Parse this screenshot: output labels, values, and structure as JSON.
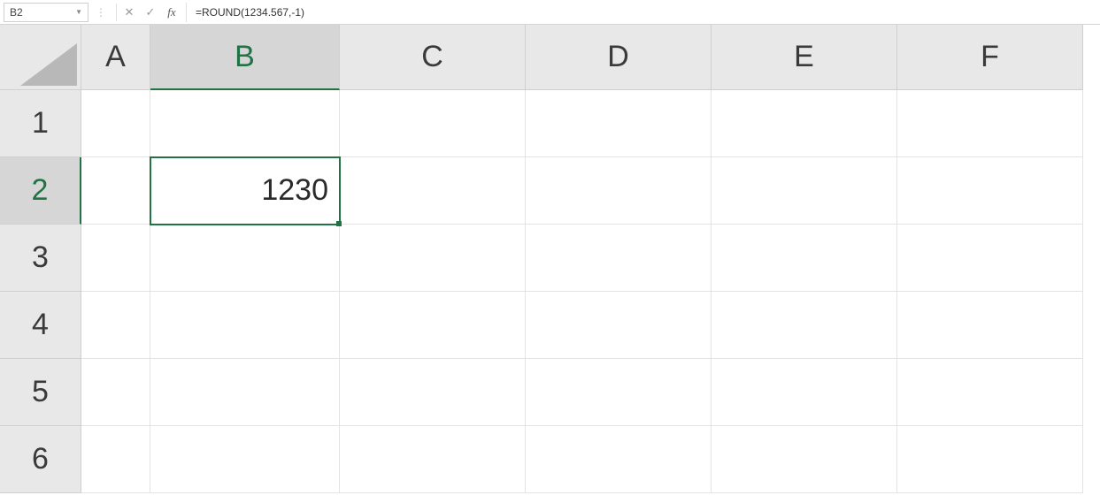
{
  "formula_bar": {
    "name_box": "B2",
    "cancel_icon": "✕",
    "enter_icon": "✓",
    "fx_label": "fx",
    "formula": "=ROUND(1234.567,-1)"
  },
  "columns": [
    "A",
    "B",
    "C",
    "D",
    "E",
    "F"
  ],
  "rows": [
    "1",
    "2",
    "3",
    "4",
    "5",
    "6"
  ],
  "active_cell": {
    "ref": "B2",
    "col": "B",
    "row": "2",
    "display_value": "1230"
  },
  "cells": {
    "B2": "1230"
  },
  "colors": {
    "accent": "#217346",
    "header_bg": "#e8e8e8"
  }
}
